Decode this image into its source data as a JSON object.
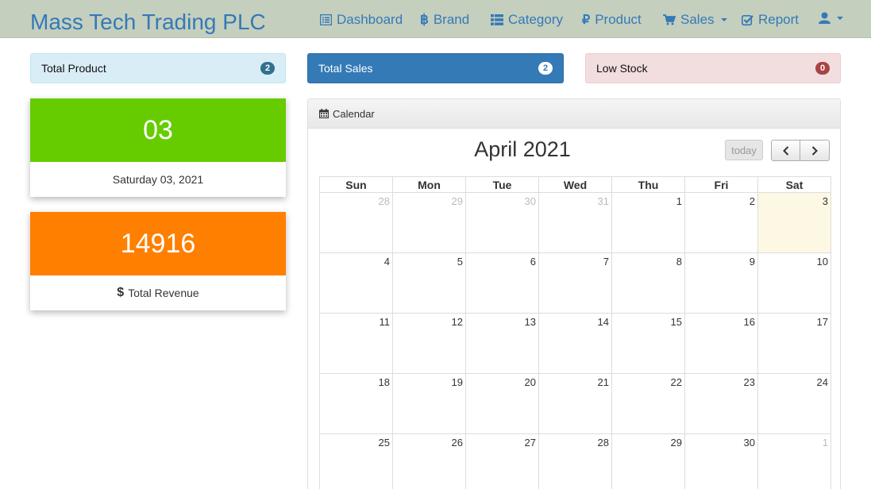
{
  "app": {
    "title": "Mass Tech Trading PLC"
  },
  "nav": {
    "dashboard": "Dashboard",
    "brand": "Brand",
    "category": "Category",
    "product": "Product",
    "sales": "Sales",
    "report": "Report"
  },
  "stats": {
    "total_product_label": "Total Product",
    "total_product_count": "2",
    "total_sales_label": "Total Sales",
    "total_sales_count": "2",
    "low_stock_label": "Low Stock",
    "low_stock_count": "0"
  },
  "date_card": {
    "day": "03",
    "caption": "Saturday 03, 2021"
  },
  "revenue_card": {
    "value": "14916",
    "currency_symbol": "$",
    "caption": "Total Revenue"
  },
  "calendar": {
    "panel_title": "Calendar",
    "month_title": "April 2021",
    "today_button": "today",
    "weekdays": [
      "Sun",
      "Mon",
      "Tue",
      "Wed",
      "Thu",
      "Fri",
      "Sat"
    ],
    "weeks": [
      [
        {
          "d": "28",
          "other": true
        },
        {
          "d": "29",
          "other": true
        },
        {
          "d": "30",
          "other": true
        },
        {
          "d": "31",
          "other": true
        },
        {
          "d": "1"
        },
        {
          "d": "2"
        },
        {
          "d": "3",
          "today": true
        }
      ],
      [
        {
          "d": "4"
        },
        {
          "d": "5"
        },
        {
          "d": "6"
        },
        {
          "d": "7"
        },
        {
          "d": "8"
        },
        {
          "d": "9"
        },
        {
          "d": "10"
        }
      ],
      [
        {
          "d": "11"
        },
        {
          "d": "12"
        },
        {
          "d": "13"
        },
        {
          "d": "14"
        },
        {
          "d": "15"
        },
        {
          "d": "16"
        },
        {
          "d": "17"
        }
      ],
      [
        {
          "d": "18"
        },
        {
          "d": "19"
        },
        {
          "d": "20"
        },
        {
          "d": "21"
        },
        {
          "d": "22"
        },
        {
          "d": "23"
        },
        {
          "d": "24"
        }
      ],
      [
        {
          "d": "25"
        },
        {
          "d": "26"
        },
        {
          "d": "27"
        },
        {
          "d": "28"
        },
        {
          "d": "29"
        },
        {
          "d": "30"
        },
        {
          "d": "1",
          "other": true
        }
      ]
    ]
  },
  "colors": {
    "navbar_bg": "#c5cfbe",
    "link": "#337ab7",
    "date_card": "#66cc00",
    "revenue_card": "#ff7f00",
    "today_cell": "#fcf8e3"
  },
  "icons": {
    "dashboard": "list-alt-icon",
    "brand": "bitcoin-icon",
    "category": "th-list-icon",
    "product": "ruble-icon",
    "sales": "shopping-cart-icon",
    "report": "check-icon",
    "user": "user-icon",
    "calendar": "calendar-icon"
  }
}
